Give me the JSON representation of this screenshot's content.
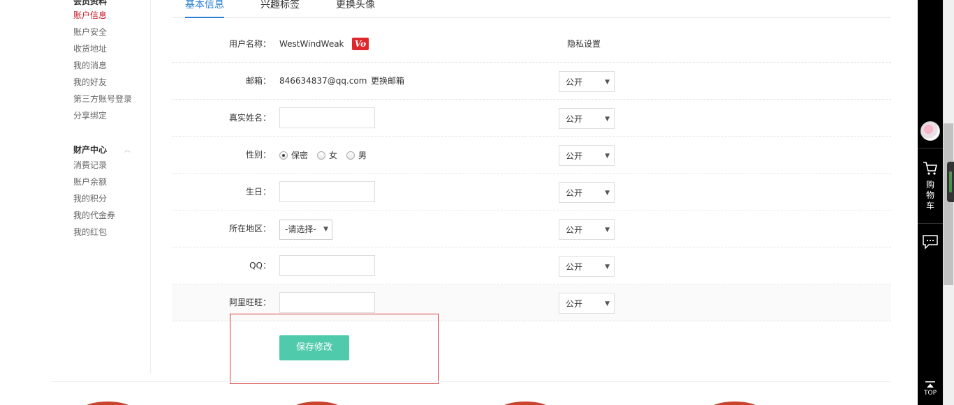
{
  "sidebar": {
    "group1_title": "会员资料",
    "group1_items": [
      "账户信息",
      "账户安全",
      "收货地址",
      "我的消息",
      "我的好友",
      "第三方账号登录",
      "分享绑定"
    ],
    "group2_title": "财产中心",
    "group2_items": [
      "消费记录",
      "账户余额",
      "我的积分",
      "我的代金券",
      "我的红包"
    ]
  },
  "tabs": [
    "基本信息",
    "兴趣标签",
    "更换头像"
  ],
  "form": {
    "username_label": "用户名称：",
    "username_value": "WestWindWeak",
    "vip_badge": "Vo",
    "privacy_title": "隐私设置",
    "email_label": "邮箱：",
    "email_value": "846634837@qq.com",
    "change_email": "更换邮箱",
    "realname_label": "真实姓名：",
    "gender_label": "性别：",
    "gender_options": [
      "保密",
      "女",
      "男"
    ],
    "gender_selected": "保密",
    "birthday_label": "生日：",
    "region_label": "所在地区：",
    "region_value": "-请选择-",
    "qq_label": "QQ：",
    "aliwangwang_label": "阿里旺旺：",
    "privacy_value": "公开",
    "save_label": "保存修改"
  },
  "toolbar": {
    "cart_label_1": "购",
    "cart_label_2": "物",
    "cart_label_3": "车",
    "top_label": "TOP"
  },
  "colors": {
    "accent_tab": "#2b7fd4",
    "active_link": "#c81623",
    "save_button": "#4fcbac",
    "highlight_border": "#d93a3a"
  }
}
